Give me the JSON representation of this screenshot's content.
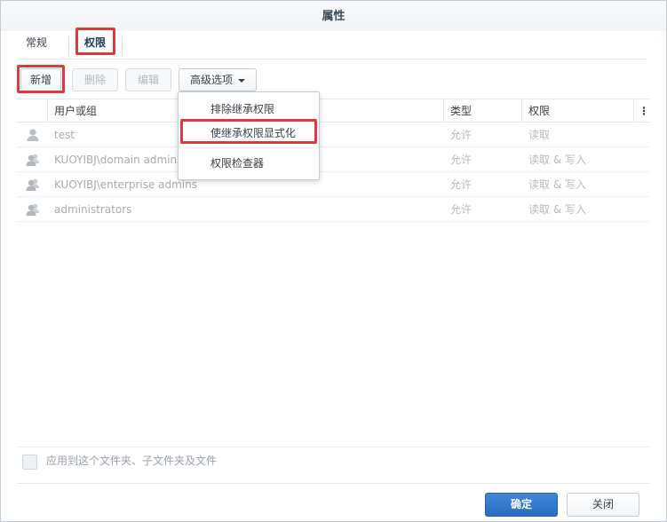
{
  "window": {
    "title": "属性"
  },
  "tabs": [
    {
      "label": "常规"
    },
    {
      "label": "权限"
    }
  ],
  "toolbar": {
    "add_label": "新增",
    "delete_label": "删除",
    "edit_label": "编辑",
    "advanced_label": "高级选项"
  },
  "advanced_menu": {
    "items": [
      {
        "label": "排除继承权限"
      },
      {
        "label": "使继承权限显式化"
      },
      {
        "label": "权限检查器"
      }
    ]
  },
  "table": {
    "columns": {
      "user": "用户或组",
      "type": "类型",
      "permission": "权限",
      "more": "⋮"
    },
    "rows": [
      {
        "icon": "user-icon",
        "user": "test",
        "type": "允许",
        "permission": "读取"
      },
      {
        "icon": "group-icon",
        "user": "KUOYIBJ\\domain admins",
        "type": "允许",
        "permission": "读取 & 写入"
      },
      {
        "icon": "group-icon",
        "user": "KUOYIBJ\\enterprise admins",
        "type": "允许",
        "permission": "读取 & 写入"
      },
      {
        "icon": "group-icon",
        "user": "administrators",
        "type": "允许",
        "permission": "读取 & 写入"
      }
    ]
  },
  "apply": {
    "label": "应用到这个文件夹、子文件夹及文件",
    "checked": false
  },
  "footer": {
    "ok_label": "确定",
    "close_label": "关闭"
  },
  "colors": {
    "highlight": "#e0393d",
    "primary": "#2a6cc0"
  }
}
